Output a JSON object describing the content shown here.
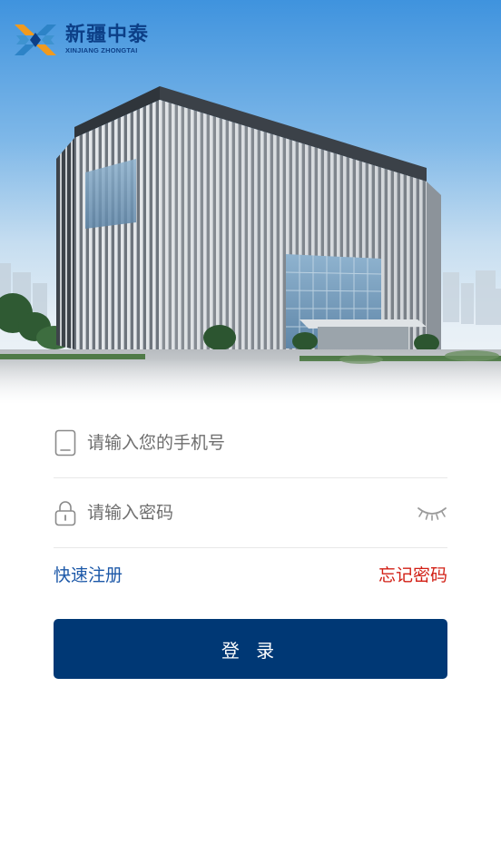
{
  "brand": {
    "name_cn": "新疆中泰",
    "name_en": "XINJIANG ZHONGTAI"
  },
  "form": {
    "phone_placeholder": "请输入您的手机号",
    "password_placeholder": "请输入密码",
    "register_link": "快速注册",
    "forgot_link": "忘记密码",
    "login_button": "登 录"
  },
  "icons": {
    "phone": "phone-icon",
    "lock": "lock-icon",
    "password_visibility": "eye-closed-icon"
  },
  "colors": {
    "brand_blue": "#003875",
    "link_blue": "#1c58a8",
    "link_red": "#d21e14"
  }
}
